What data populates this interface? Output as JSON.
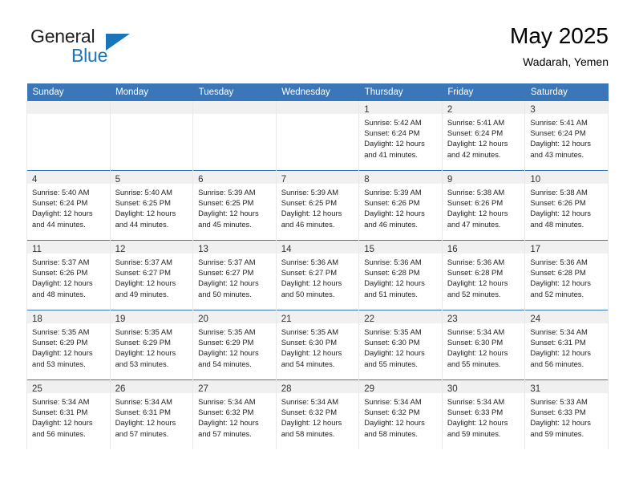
{
  "brand": {
    "name_part1": "General",
    "name_part2": "Blue",
    "triangle_color": "#1b75bb",
    "text_color": "#231f20"
  },
  "header": {
    "title": "May 2025",
    "subtitle": "Wadarah, Yemen"
  },
  "theme": {
    "header_bg": "#3b76b8",
    "header_text": "#ffffff",
    "daynum_band_bg": "#f0f0f0",
    "cell_bg": "#ffffff",
    "week_separator": "#3b76b8"
  },
  "weekday_headers": [
    "Sunday",
    "Monday",
    "Tuesday",
    "Wednesday",
    "Thursday",
    "Friday",
    "Saturday"
  ],
  "weeks": [
    [
      {
        "day": "",
        "lines": []
      },
      {
        "day": "",
        "lines": []
      },
      {
        "day": "",
        "lines": []
      },
      {
        "day": "",
        "lines": []
      },
      {
        "day": "1",
        "lines": [
          "Sunrise: 5:42 AM",
          "Sunset: 6:24 PM",
          "Daylight: 12 hours",
          "and 41 minutes."
        ]
      },
      {
        "day": "2",
        "lines": [
          "Sunrise: 5:41 AM",
          "Sunset: 6:24 PM",
          "Daylight: 12 hours",
          "and 42 minutes."
        ]
      },
      {
        "day": "3",
        "lines": [
          "Sunrise: 5:41 AM",
          "Sunset: 6:24 PM",
          "Daylight: 12 hours",
          "and 43 minutes."
        ]
      }
    ],
    [
      {
        "day": "4",
        "lines": [
          "Sunrise: 5:40 AM",
          "Sunset: 6:24 PM",
          "Daylight: 12 hours",
          "and 44 minutes."
        ]
      },
      {
        "day": "5",
        "lines": [
          "Sunrise: 5:40 AM",
          "Sunset: 6:25 PM",
          "Daylight: 12 hours",
          "and 44 minutes."
        ]
      },
      {
        "day": "6",
        "lines": [
          "Sunrise: 5:39 AM",
          "Sunset: 6:25 PM",
          "Daylight: 12 hours",
          "and 45 minutes."
        ]
      },
      {
        "day": "7",
        "lines": [
          "Sunrise: 5:39 AM",
          "Sunset: 6:25 PM",
          "Daylight: 12 hours",
          "and 46 minutes."
        ]
      },
      {
        "day": "8",
        "lines": [
          "Sunrise: 5:39 AM",
          "Sunset: 6:26 PM",
          "Daylight: 12 hours",
          "and 46 minutes."
        ]
      },
      {
        "day": "9",
        "lines": [
          "Sunrise: 5:38 AM",
          "Sunset: 6:26 PM",
          "Daylight: 12 hours",
          "and 47 minutes."
        ]
      },
      {
        "day": "10",
        "lines": [
          "Sunrise: 5:38 AM",
          "Sunset: 6:26 PM",
          "Daylight: 12 hours",
          "and 48 minutes."
        ]
      }
    ],
    [
      {
        "day": "11",
        "lines": [
          "Sunrise: 5:37 AM",
          "Sunset: 6:26 PM",
          "Daylight: 12 hours",
          "and 48 minutes."
        ]
      },
      {
        "day": "12",
        "lines": [
          "Sunrise: 5:37 AM",
          "Sunset: 6:27 PM",
          "Daylight: 12 hours",
          "and 49 minutes."
        ]
      },
      {
        "day": "13",
        "lines": [
          "Sunrise: 5:37 AM",
          "Sunset: 6:27 PM",
          "Daylight: 12 hours",
          "and 50 minutes."
        ]
      },
      {
        "day": "14",
        "lines": [
          "Sunrise: 5:36 AM",
          "Sunset: 6:27 PM",
          "Daylight: 12 hours",
          "and 50 minutes."
        ]
      },
      {
        "day": "15",
        "lines": [
          "Sunrise: 5:36 AM",
          "Sunset: 6:28 PM",
          "Daylight: 12 hours",
          "and 51 minutes."
        ]
      },
      {
        "day": "16",
        "lines": [
          "Sunrise: 5:36 AM",
          "Sunset: 6:28 PM",
          "Daylight: 12 hours",
          "and 52 minutes."
        ]
      },
      {
        "day": "17",
        "lines": [
          "Sunrise: 5:36 AM",
          "Sunset: 6:28 PM",
          "Daylight: 12 hours",
          "and 52 minutes."
        ]
      }
    ],
    [
      {
        "day": "18",
        "lines": [
          "Sunrise: 5:35 AM",
          "Sunset: 6:29 PM",
          "Daylight: 12 hours",
          "and 53 minutes."
        ]
      },
      {
        "day": "19",
        "lines": [
          "Sunrise: 5:35 AM",
          "Sunset: 6:29 PM",
          "Daylight: 12 hours",
          "and 53 minutes."
        ]
      },
      {
        "day": "20",
        "lines": [
          "Sunrise: 5:35 AM",
          "Sunset: 6:29 PM",
          "Daylight: 12 hours",
          "and 54 minutes."
        ]
      },
      {
        "day": "21",
        "lines": [
          "Sunrise: 5:35 AM",
          "Sunset: 6:30 PM",
          "Daylight: 12 hours",
          "and 54 minutes."
        ]
      },
      {
        "day": "22",
        "lines": [
          "Sunrise: 5:35 AM",
          "Sunset: 6:30 PM",
          "Daylight: 12 hours",
          "and 55 minutes."
        ]
      },
      {
        "day": "23",
        "lines": [
          "Sunrise: 5:34 AM",
          "Sunset: 6:30 PM",
          "Daylight: 12 hours",
          "and 55 minutes."
        ]
      },
      {
        "day": "24",
        "lines": [
          "Sunrise: 5:34 AM",
          "Sunset: 6:31 PM",
          "Daylight: 12 hours",
          "and 56 minutes."
        ]
      }
    ],
    [
      {
        "day": "25",
        "lines": [
          "Sunrise: 5:34 AM",
          "Sunset: 6:31 PM",
          "Daylight: 12 hours",
          "and 56 minutes."
        ]
      },
      {
        "day": "26",
        "lines": [
          "Sunrise: 5:34 AM",
          "Sunset: 6:31 PM",
          "Daylight: 12 hours",
          "and 57 minutes."
        ]
      },
      {
        "day": "27",
        "lines": [
          "Sunrise: 5:34 AM",
          "Sunset: 6:32 PM",
          "Daylight: 12 hours",
          "and 57 minutes."
        ]
      },
      {
        "day": "28",
        "lines": [
          "Sunrise: 5:34 AM",
          "Sunset: 6:32 PM",
          "Daylight: 12 hours",
          "and 58 minutes."
        ]
      },
      {
        "day": "29",
        "lines": [
          "Sunrise: 5:34 AM",
          "Sunset: 6:32 PM",
          "Daylight: 12 hours",
          "and 58 minutes."
        ]
      },
      {
        "day": "30",
        "lines": [
          "Sunrise: 5:34 AM",
          "Sunset: 6:33 PM",
          "Daylight: 12 hours",
          "and 59 minutes."
        ]
      },
      {
        "day": "31",
        "lines": [
          "Sunrise: 5:33 AM",
          "Sunset: 6:33 PM",
          "Daylight: 12 hours",
          "and 59 minutes."
        ]
      }
    ]
  ]
}
